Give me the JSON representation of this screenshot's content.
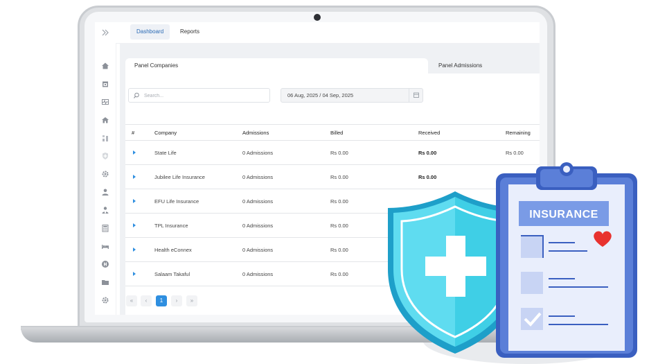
{
  "header": {
    "tabs": [
      {
        "label": "Dashboard",
        "active": true
      },
      {
        "label": "Reports",
        "active": false
      }
    ]
  },
  "sidebar": {
    "icons": [
      "expand-chevrons-icon",
      "home-icon",
      "calendar-icon",
      "activity-icon",
      "building-icon",
      "grid-icon",
      "shield-icon",
      "gear-icon",
      "user-icon",
      "user-group-icon",
      "calculator-icon",
      "bed-icon",
      "hospital-icon",
      "folder-icon",
      "settings-icon"
    ]
  },
  "panel_tabs": [
    {
      "label": "Panel Companies",
      "active": true
    },
    {
      "label": "Panel Admissions",
      "active": false
    }
  ],
  "filters": {
    "search_placeholder": "Search...",
    "date_range": "06 Aug, 2025 / 04 Sep, 2025"
  },
  "table": {
    "columns": [
      "#",
      "Company",
      "Admissions",
      "Billed",
      "Received",
      "Remaining"
    ],
    "rows": [
      {
        "company": "State Life",
        "admissions": "0 Admissions",
        "billed": "Rs 0.00",
        "received": "Rs 0.00",
        "remaining": "Rs 0.00"
      },
      {
        "company": "Jubilee Life Insurance",
        "admissions": "0 Admissions",
        "billed": "Rs 0.00",
        "received": "Rs 0.00",
        "remaining": ""
      },
      {
        "company": "EFU Life Insurance",
        "admissions": "0 Admissions",
        "billed": "Rs 0.00",
        "received": "",
        "remaining": ""
      },
      {
        "company": "TPL Insurance",
        "admissions": "0 Admissions",
        "billed": "Rs 0.00",
        "received": "",
        "remaining": ""
      },
      {
        "company": "Health eConnex",
        "admissions": "0 Admissions",
        "billed": "Rs 0.00",
        "received": "",
        "remaining": ""
      },
      {
        "company": "Salaam Takaful",
        "admissions": "0 Admissions",
        "billed": "Rs 0.00",
        "received": "",
        "remaining": ""
      }
    ]
  },
  "pagination": {
    "first": "«",
    "prev": "‹",
    "current": "1",
    "next": "›",
    "last": "»"
  },
  "illustration": {
    "clipboard_label": "INSURANCE",
    "shield_color": "#5fdcf0",
    "clipboard_color": "#5b7fd8",
    "heart_color": "#e8322f"
  },
  "colors": {
    "accent": "#2f8fe0",
    "active_tab_text": "#2a6ab5"
  }
}
